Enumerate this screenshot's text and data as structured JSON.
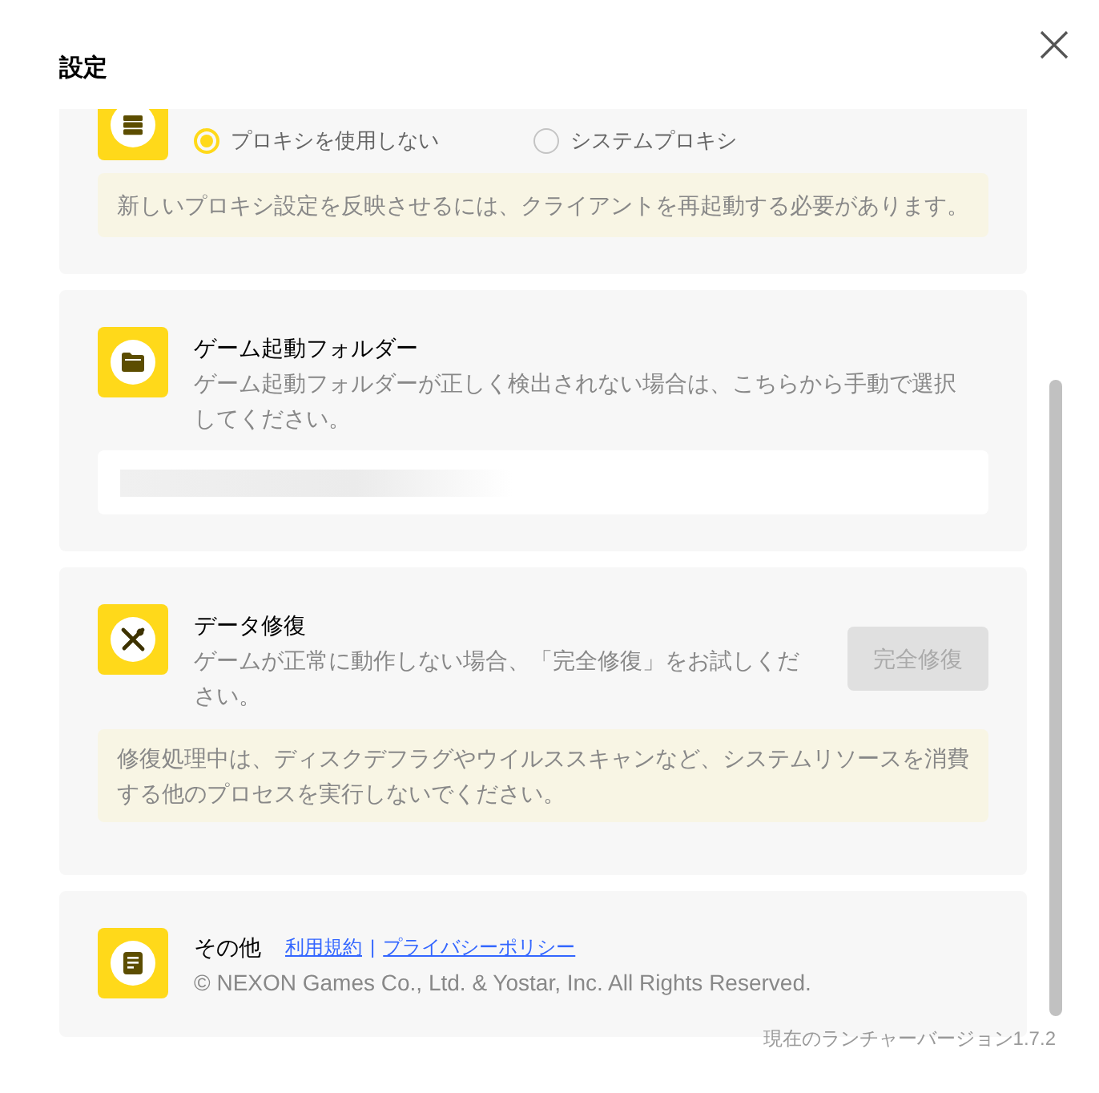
{
  "window": {
    "title": "設定"
  },
  "proxy": {
    "options": [
      {
        "label": "プロキシを使用しない",
        "selected": true
      },
      {
        "label": "システムプロキシ",
        "selected": false
      }
    ],
    "note": "新しいプロキシ設定を反映させるには、クライアントを再起動する必要があります。"
  },
  "game_folder": {
    "title": "ゲーム起動フォルダー",
    "description": "ゲーム起動フォルダーが正しく検出されない場合は、こちらから手動で選択してください。"
  },
  "data_repair": {
    "title": "データ修復",
    "description": "ゲームが正常に動作しない場合、「完全修復」をお試しください。",
    "button": {
      "label": "完全修復",
      "disabled": true
    },
    "note": "修復処理中は、ディスクデフラグやウイルススキャンなど、システムリソースを消費する他のプロセスを実行しないでください。"
  },
  "other": {
    "title": "その他",
    "links": [
      "利用規約",
      "プライバシーポリシー"
    ],
    "separator": "|",
    "copyright": "© NEXON Games Co., Ltd. & Yostar, Inc. All Rights Reserved."
  },
  "version": "現在のランチャーバージョン1.7.2"
}
